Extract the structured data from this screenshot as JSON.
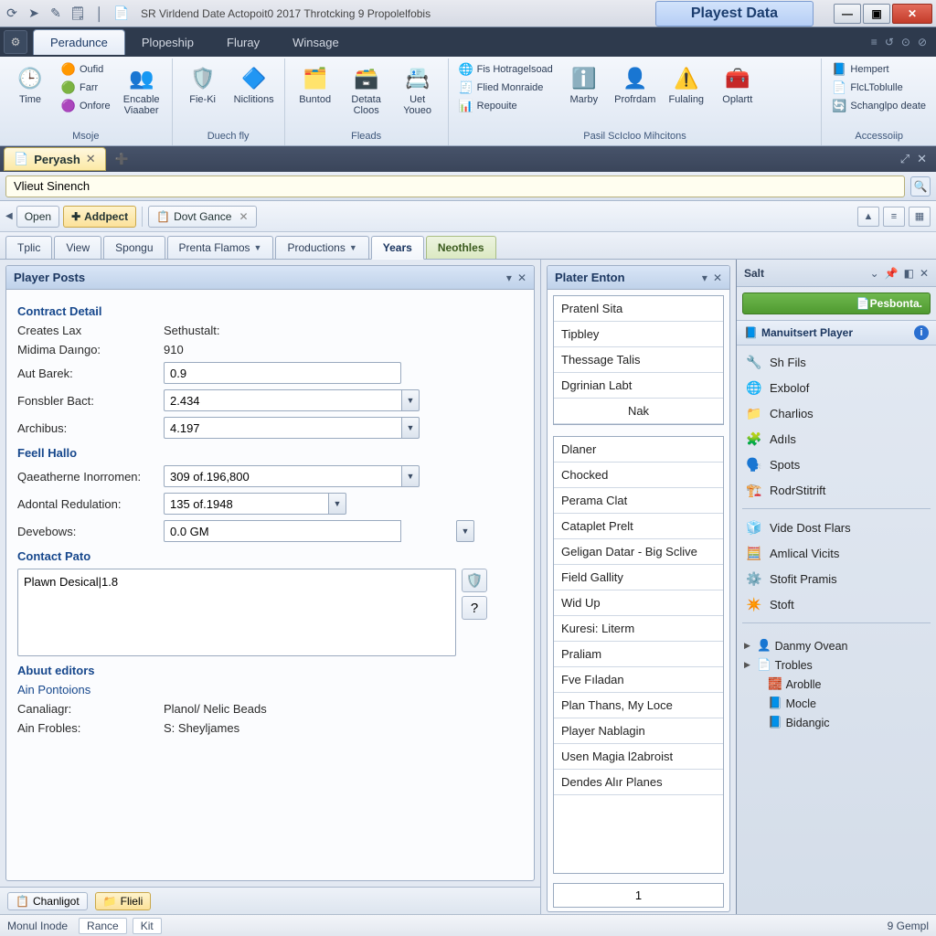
{
  "colors": {
    "accent": "#1c3760",
    "ribbon_bg": "#e5ecf7",
    "brand_green": "#4f9a30"
  },
  "titlebar": {
    "qat_icons": [
      "refresh-icon",
      "forward-icon",
      "edit-icon",
      "note-icon"
    ],
    "app_title": "SR Virldend Date Actopoit0 2017 Throtcking 9 Propolelfobis",
    "pill": "Playest Data",
    "win": {
      "min": "—",
      "max": "▣",
      "close": "✕"
    }
  },
  "menubar": {
    "tabs": [
      "Peradunce",
      "Plopeship",
      "Fluray",
      "Winsage"
    ],
    "active": 0,
    "right": [
      "≡",
      "↺",
      "⊙",
      "⊘"
    ]
  },
  "ribbon": {
    "groups": [
      {
        "label": "Msoje",
        "big": [
          {
            "icon": "🕒",
            "text": "Time"
          }
        ],
        "small": [
          [
            "🟠",
            "Oufid"
          ],
          [
            "🟢",
            "Farr"
          ],
          [
            "🟣",
            "Onfore"
          ]
        ],
        "big2": [
          {
            "icon": "👥",
            "text": "Encable Viaaber"
          }
        ]
      },
      {
        "label": "Duech fly",
        "big": [
          {
            "icon": "🛡️",
            "text": "Fie-Ki"
          },
          {
            "icon": "🔷",
            "text": "Niclitions"
          }
        ]
      },
      {
        "label": "Fleads",
        "big": [
          {
            "icon": "🗂️",
            "text": "Buntod"
          },
          {
            "icon": "🗃️",
            "text": "Detata Cloos"
          },
          {
            "icon": "📇",
            "text": "Uet Youeo"
          }
        ]
      },
      {
        "label": "Pasil ScIcloo Mihcitons",
        "small": [
          [
            "🌐",
            "Fis Hotragelsoad"
          ],
          [
            "🧾",
            "Flied Monraide"
          ],
          [
            "📊",
            "Repouite"
          ]
        ],
        "big": [
          {
            "icon": "ℹ️",
            "text": "Marby"
          },
          {
            "icon": "👤",
            "text": "Profrdam"
          },
          {
            "icon": "⚠️",
            "text": "Fulaling"
          },
          {
            "icon": "🧰",
            "text": "Oplartt"
          }
        ]
      },
      {
        "label": "Accessoiip",
        "small": [
          [
            "📘",
            "Hempert"
          ],
          [
            "📄",
            "FlcLToblulle"
          ],
          [
            "🔄",
            "Schanglpo deate"
          ]
        ]
      }
    ]
  },
  "doctab": {
    "icon": "📄",
    "title": "Peryash",
    "plus": "➕"
  },
  "search": {
    "value": "Vlieut Sinench"
  },
  "toolbar2": {
    "open": "Open",
    "add": "Addpect",
    "doc": "Dovt Gance",
    "rbtns": [
      "▲",
      "≡",
      "▦"
    ]
  },
  "tabs": [
    {
      "label": "Tplic",
      "dd": false
    },
    {
      "label": "View",
      "dd": false
    },
    {
      "label": "Spongu",
      "dd": false
    },
    {
      "label": "Prenta Flamos",
      "dd": true
    },
    {
      "label": "Productions",
      "dd": true
    },
    {
      "label": "Years",
      "dd": false,
      "active": true
    },
    {
      "label": "Neothles",
      "dd": false,
      "green": true
    }
  ],
  "player_posts": {
    "title": "Player Posts",
    "sect1": "Contract Detail",
    "rows1": [
      {
        "l": "Creates Lax",
        "v": "Sethustalt:"
      },
      {
        "l": "Midima Daıngo:",
        "v": "910"
      }
    ],
    "inputs1": [
      {
        "l": "Aut Barek:",
        "v": "0.9",
        "combo": false
      },
      {
        "l": "Fonsbler Bact:",
        "v": "2.434",
        "combo": true
      },
      {
        "l": "Archibus:",
        "v": "4.197",
        "combo": true
      }
    ],
    "sect2": "Feell Hallo",
    "inputs2": [
      {
        "l": "Qaeatherne Inorromen:",
        "v": "309 of.196,800",
        "combo": true
      },
      {
        "l": "Adontal Redulation:",
        "v": "135 of.1948",
        "combo": true,
        "narrow": true
      },
      {
        "l": "Devebows:",
        "v": "0.0 GM",
        "combo": true
      }
    ],
    "sect3": "Contact Pato",
    "textarea": "Plawn Desical|1.8",
    "side_icons": [
      "🛡️",
      "?"
    ],
    "sect4": "Abuut editors",
    "sub4": "Ain Pontoions",
    "rows4": [
      {
        "l": "Canaliagr:",
        "v": "Planol/ Nelic Beads"
      },
      {
        "l": "Ain Frobles:",
        "v": "S: Sheyljames"
      }
    ]
  },
  "plater": {
    "title": "Plater Enton",
    "items": [
      "Pratenl Sita",
      "Tipbley",
      "Thessage Talis",
      "Dgrinian Labt"
    ],
    "nak": "Nak",
    "items2": [
      "Dlaner",
      "Chocked",
      "Perama Clat",
      "Cataplet Prelt",
      "Geligan Datar - Big Sclive",
      "Field Gallity",
      "Wid Up",
      "Kuresi: Literm",
      "Praliam",
      "Fve Fıladan",
      "Plan Thans, My Loce",
      "Player Nablagin",
      "Usen Magia l2abroist",
      "Dendes Alır Planes"
    ],
    "page": "1"
  },
  "right": {
    "hdr": "Salt",
    "green": "Pesbonta.",
    "cap": "Manuitsert Player",
    "nav1": [
      [
        "🔧",
        "Sh Fils"
      ],
      [
        "🌐",
        "Exbolof"
      ],
      [
        "📁",
        "Charlios"
      ],
      [
        "🧩",
        "Adıls"
      ],
      [
        "🗣️",
        "Spots"
      ],
      [
        "🏗️",
        "RodrStitrift"
      ]
    ],
    "nav2": [
      [
        "🧊",
        "Vide Dost Flars"
      ],
      [
        "🧮",
        "Amlical Vicits"
      ],
      [
        "⚙️",
        "Stofit Pramis"
      ],
      [
        "✴️",
        "Stoft"
      ]
    ],
    "tree": [
      {
        "tw": "▶",
        "ic": "👤",
        "t": "Danmy Ovean"
      },
      {
        "tw": "▶",
        "ic": "📄",
        "t": "Trobles"
      },
      {
        "tw": "",
        "ic": "🧱",
        "t": "Aroblle",
        "lvl": 1
      },
      {
        "tw": "",
        "ic": "📘",
        "t": "Mocle",
        "lvl": 1
      },
      {
        "tw": "",
        "ic": "📘",
        "t": "Bidangic",
        "lvl": 1
      }
    ]
  },
  "bottombar": {
    "b1": "Chanligot",
    "b2": "Flieli"
  },
  "statusbar": {
    "mode": "Monul Inode",
    "rance": "Rance",
    "kit": "Kit",
    "right": "9 Gempl"
  }
}
